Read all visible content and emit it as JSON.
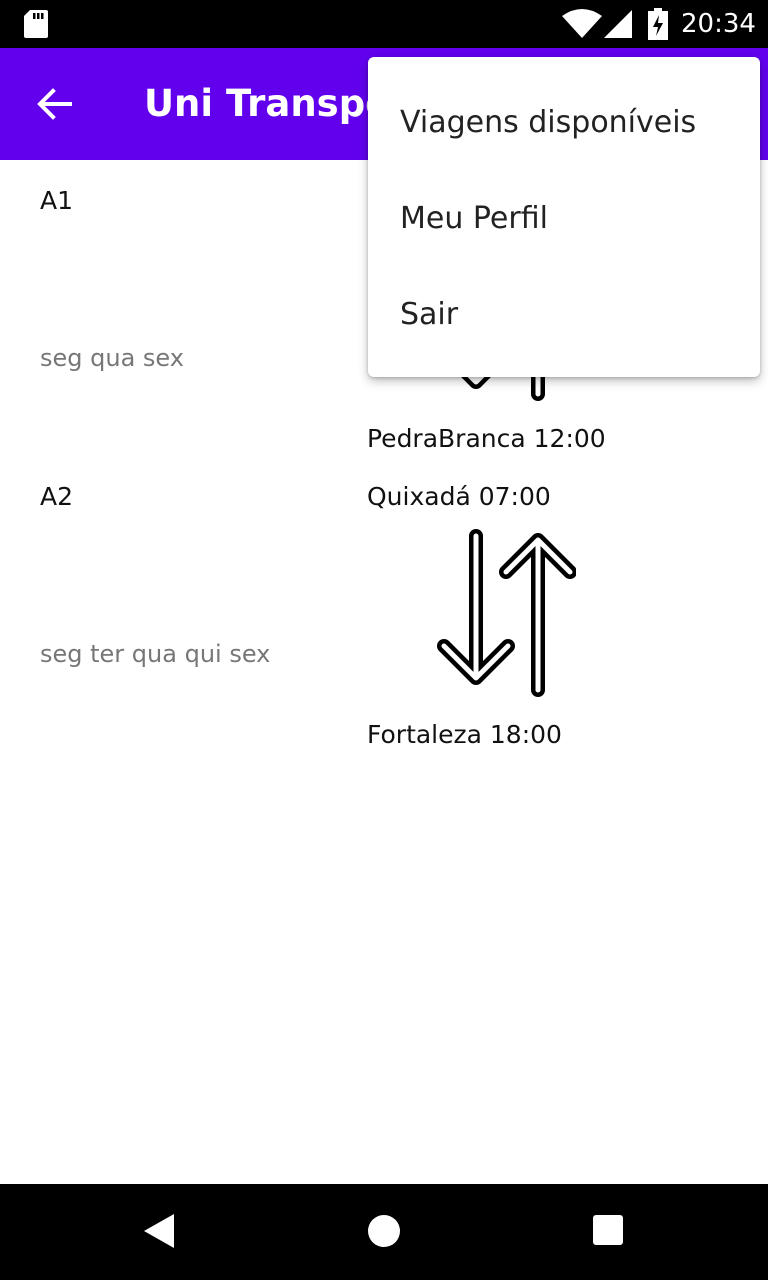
{
  "status_bar": {
    "time": "20:34",
    "icons": [
      "sd-card-icon",
      "wifi-icon",
      "signal-icon",
      "battery-charging-icon"
    ]
  },
  "app_bar": {
    "title": "Uni Transpo",
    "back_icon": "arrow-back-icon",
    "color": "#6200ee"
  },
  "trips": [
    {
      "code": "A1",
      "days": "seg qua sex",
      "origin": "",
      "destination": "PedraBranca 12:00"
    },
    {
      "code": "A2",
      "days": "seg ter qua qui sex",
      "origin": "Quixadá 07:00",
      "destination": "Fortaleza 18:00"
    }
  ],
  "menu": {
    "items": [
      "Viagens disponíveis",
      "Meu Perfil",
      "Sair"
    ]
  },
  "nav_bar": {
    "icons": [
      "back-triangle-icon",
      "home-circle-icon",
      "recents-square-icon"
    ]
  }
}
